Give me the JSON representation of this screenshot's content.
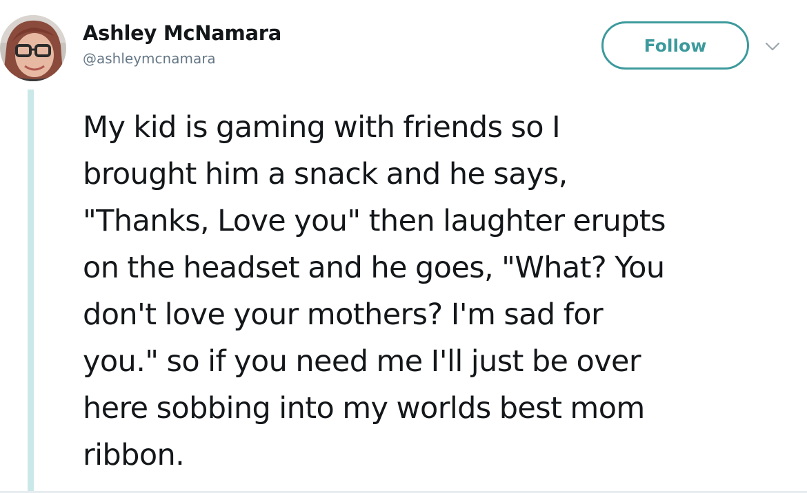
{
  "user": {
    "display_name": "Ashley McNamara",
    "handle": "@ashleymcnamara",
    "avatar_icon": "profile-photo"
  },
  "actions": {
    "follow_label": "Follow",
    "menu_icon": "chevron-down-icon"
  },
  "tweet": {
    "lines": [
      "My kid is gaming with friends so I",
      "brought him a snack and he says,",
      "\"Thanks, Love you\" then laughter erupts",
      "on the headset and he goes, \"What? You",
      "don't love your mothers? I'm sad for",
      "you.\" so if you need me I'll just be over",
      "here sobbing into my worlds best mom",
      "ribbon."
    ]
  },
  "colors": {
    "accent": "#3d9a9c",
    "thread_line": "#cbe8e8",
    "text": "#14171a",
    "secondary_text": "#657786"
  }
}
